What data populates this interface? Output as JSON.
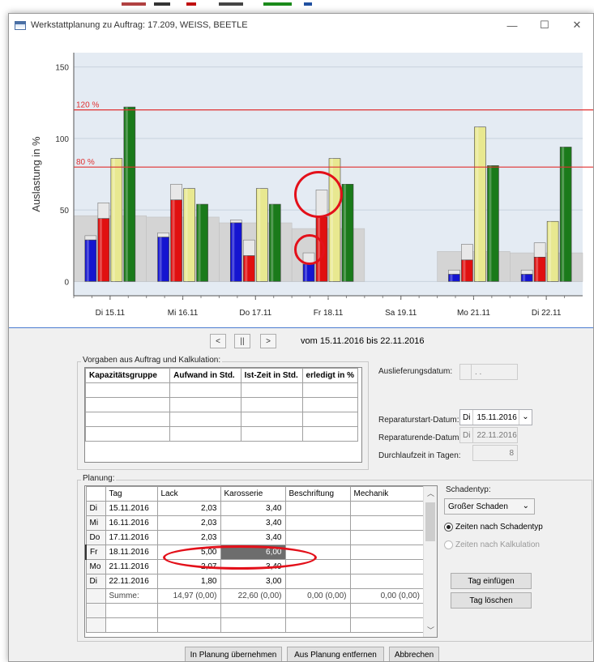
{
  "window": {
    "title": "Werkstattplanung zu Auftrag: 17.209, WEISS, BEETLE",
    "minimize": "—",
    "maximize": "☐",
    "close": "✕"
  },
  "chart_data": {
    "type": "bar",
    "ylabel": "Auslastung in %",
    "ylim": [
      -10,
      160
    ],
    "yticks": [
      0,
      50,
      100,
      150
    ],
    "reference_lines": [
      {
        "label": "120 %",
        "value": 120,
        "color": "#e03030"
      },
      {
        "label": "80 %",
        "value": 80,
        "color": "#e03030"
      }
    ],
    "categories": [
      "Di 15.11",
      "Mi 16.11",
      "Do 17.11",
      "Fr 18.11",
      "Sa 19.11",
      "Mo 21.11",
      "Di 22.11"
    ],
    "capacity": [
      46,
      45,
      41,
      37,
      0,
      21,
      20
    ],
    "series": [
      {
        "color": "#1515d0",
        "values": [
          29,
          31,
          41,
          12,
          0,
          5,
          5
        ],
        "caps": [
          32,
          34,
          43,
          20,
          0,
          8,
          8
        ]
      },
      {
        "color": "#e01010",
        "values": [
          44,
          57,
          18,
          45,
          0,
          15,
          17
        ],
        "caps": [
          55,
          68,
          29,
          64,
          0,
          26,
          27
        ]
      },
      {
        "color": "#e8e890",
        "values": [
          86,
          65,
          65,
          86,
          0,
          108,
          42
        ]
      },
      {
        "color": "#1a7a1a",
        "values": [
          122,
          54,
          54,
          68,
          0,
          81,
          94
        ]
      }
    ]
  },
  "nav": {
    "prev": "<",
    "pause": "||",
    "next": ">",
    "range": "vom 15.11.2016 bis 22.11.2016"
  },
  "vorgaben": {
    "label": "Vorgaben aus Auftrag und  Kalkulation:",
    "headers": [
      "Kapazitätsgruppe",
      "Aufwand in Std.",
      "Ist-Zeit in Std.",
      "erledigt in %"
    ]
  },
  "dates": {
    "auslieferung_label": "Auslieferungsdatum:",
    "auslieferung_value": ". .",
    "start_label": "Reparaturstart-Datum:",
    "start_day": "Di",
    "start_value": "15.11.2016",
    "end_label": "Reparaturende-Datum:",
    "end_day": "Di",
    "end_value": "22.11.2016",
    "duration_label": "Durchlaufzeit in Tagen:",
    "duration_value": "8"
  },
  "planung": {
    "label": "Planung:",
    "headers": [
      "Tag",
      "Lack",
      "Karosserie",
      "Beschriftung",
      "Mechanik"
    ],
    "rows": [
      {
        "day": "Di",
        "date": "15.11.2016",
        "lack": "2,03",
        "karosserie": "3,40"
      },
      {
        "day": "Mi",
        "date": "16.11.2016",
        "lack": "2,03",
        "karosserie": "3,40"
      },
      {
        "day": "Do",
        "date": "17.11.2016",
        "lack": "2,03",
        "karosserie": "3,40"
      },
      {
        "day": "Fr",
        "date": "18.11.2016",
        "lack": "5,00",
        "karosserie": "6,00"
      },
      {
        "day": "Mo",
        "date": "21.11.2016",
        "lack": "2,07",
        "karosserie": "3,40"
      },
      {
        "day": "Di",
        "date": "22.11.2016",
        "lack": "1,80",
        "karosserie": "3,00"
      }
    ],
    "summe": {
      "label": "Summe:",
      "lack": "14,97 (0,00)",
      "karosserie": "22,60 (0,00)",
      "beschriftung": "0,00 (0,00)",
      "mechanik": "0,00 (0,00)"
    }
  },
  "schaden": {
    "label": "Schadentyp:",
    "value": "Großer Schaden",
    "radio1": "Zeiten nach Schadentyp",
    "radio2": "Zeiten nach Kalkulation",
    "tag_einfuegen": "Tag einfügen",
    "tag_loeschen": "Tag löschen"
  },
  "footer": {
    "uebernehmen": "In Planung übernehmen",
    "entfernen": "Aus Planung entfernen",
    "abbrechen": "Abbrechen"
  }
}
